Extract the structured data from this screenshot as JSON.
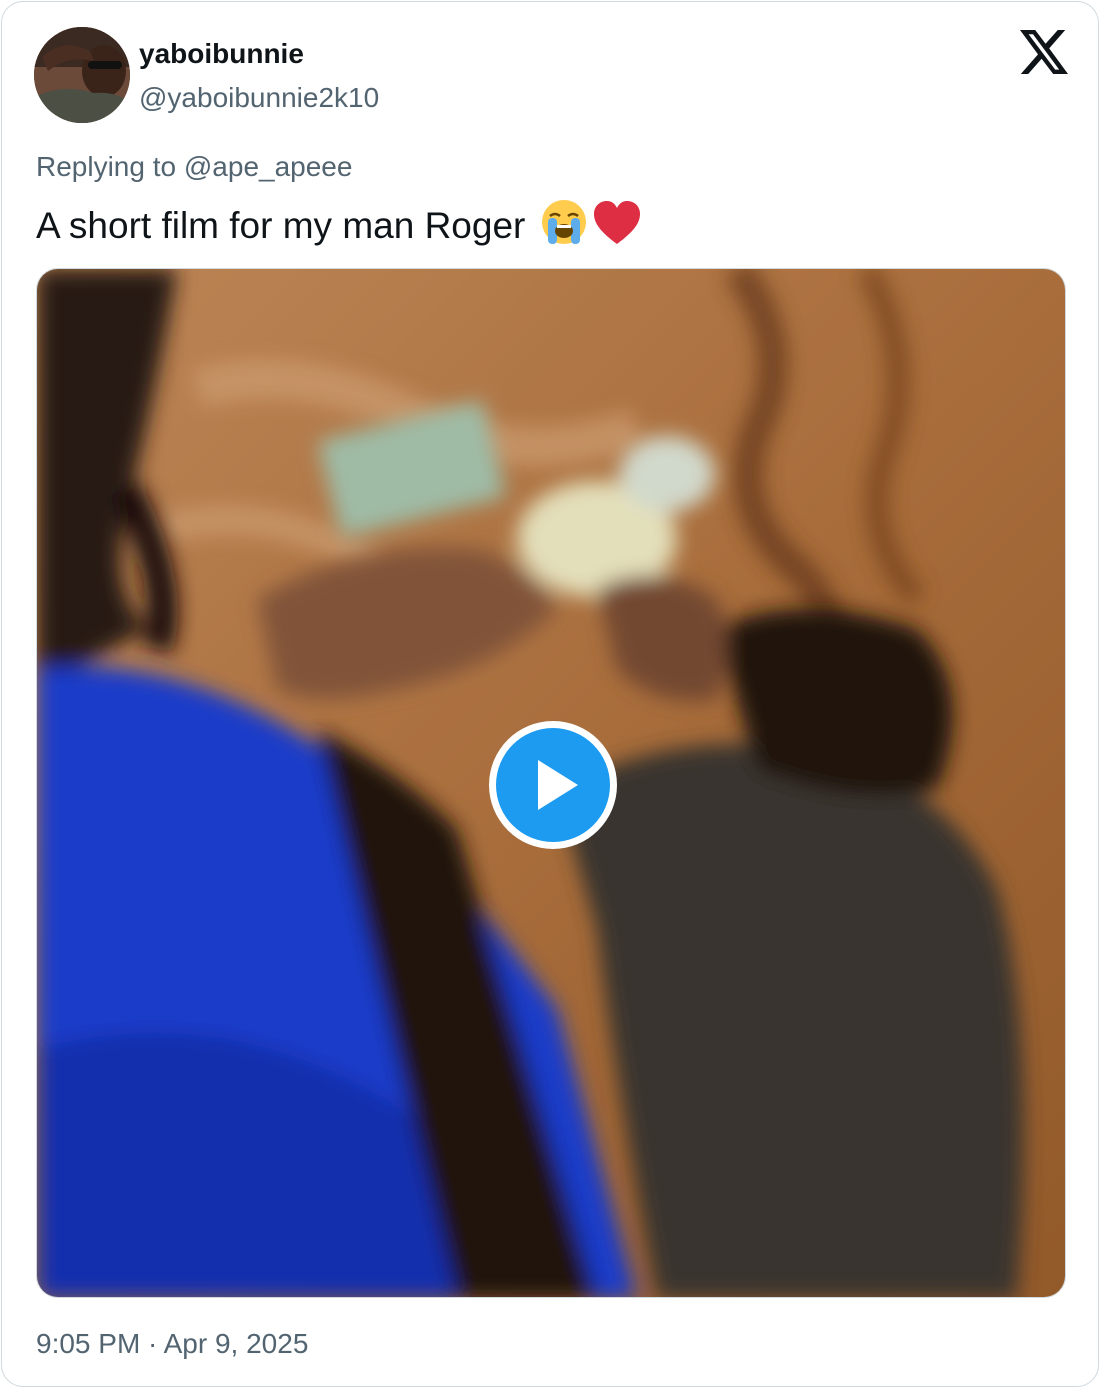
{
  "tweet": {
    "author": {
      "display_name": "yaboibunnie",
      "handle": "@yaboibunnie2k10",
      "avatar_icon": "user-avatar"
    },
    "platform_icon": "x-logo-icon",
    "reply": {
      "prefix": "Replying to",
      "mention": "@ape_apeee"
    },
    "text": "A short film for my man Roger",
    "emojis": [
      "loudly-crying-face-emoji",
      "red-heart-emoji"
    ],
    "media": {
      "type": "video",
      "play_icon": "play-icon",
      "play_color": "#1d9bf0"
    },
    "timestamp": "9:05 PM · Apr 9, 2025"
  }
}
